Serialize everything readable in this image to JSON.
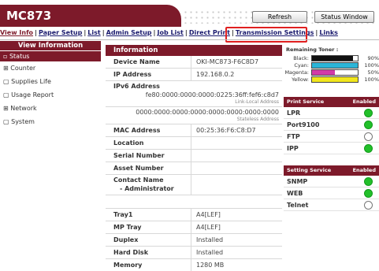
{
  "header": {
    "title": "MC873",
    "refresh_label": "Refresh",
    "status_window_label": "Status Window"
  },
  "nav": {
    "items": [
      {
        "label": "View Info"
      },
      {
        "label": "Paper Setup"
      },
      {
        "label": "List"
      },
      {
        "label": "Admin Setup"
      },
      {
        "label": "Job List"
      },
      {
        "label": "Direct Print"
      },
      {
        "label": "Transmission Settings"
      },
      {
        "label": "Links"
      }
    ]
  },
  "sidebar": {
    "header": "View Information",
    "items": [
      {
        "label": "Status",
        "icon": "bullet"
      },
      {
        "label": "Counter",
        "icon": "plus"
      },
      {
        "label": "Supplies Life",
        "icon": "bullet"
      },
      {
        "label": "Usage Report",
        "icon": "bullet"
      },
      {
        "label": "Network",
        "icon": "plus"
      },
      {
        "label": "System",
        "icon": "bullet"
      }
    ]
  },
  "info": {
    "header": "Information",
    "device_name_label": "Device Name",
    "device_name": "OKI-MC873-F6C8D7",
    "ip_label": "IP Address",
    "ip": "192.168.0.2",
    "ipv6_label": "IPv6 Address",
    "ipv6_link_local": "fe80:0000:0000:0000:0225:36ff:fef6:c8d7",
    "ipv6_link_local_note": "Link-Local Address",
    "ipv6_stateless": "0000:0000:0000:0000:0000:0000:0000:0000",
    "ipv6_stateless_note": "Stateless Address",
    "mac_label": "MAC Address",
    "mac": "00:25:36:F6:C8:D7",
    "location_label": "Location",
    "serial_label": "Serial Number",
    "asset_label": "Asset Number",
    "contact_label": "Contact Name",
    "contact_sub": "- Administrator",
    "tray1_label": "Tray1",
    "tray1": "A4[LEF]",
    "mptray_label": "MP Tray",
    "mptray": "A4[LEF]",
    "duplex_label": "Duplex",
    "duplex": "Installed",
    "hdd_label": "Hard Disk",
    "hdd": "Installed",
    "memory_label": "Memory",
    "memory": "1280 MB"
  },
  "toner": {
    "title": "Remaining Toner :",
    "items": [
      {
        "label": "Black:",
        "pct": "90%",
        "level": 0.9,
        "color": "#111111"
      },
      {
        "label": "Cyan:",
        "pct": "100%",
        "level": 1.0,
        "color": "#2bb5d8"
      },
      {
        "label": "Magenta:",
        "pct": "50%",
        "level": 0.5,
        "color": "#d23aa8"
      },
      {
        "label": "Yellow:",
        "pct": "100%",
        "level": 1.0,
        "color": "#f1e61c"
      }
    ]
  },
  "print_service": {
    "header": "Print Service",
    "enabled_header": "Enabled",
    "items": [
      {
        "name": "LPR",
        "enabled": true
      },
      {
        "name": "Port9100",
        "enabled": true
      },
      {
        "name": "FTP",
        "enabled": false
      },
      {
        "name": "IPP",
        "enabled": true
      }
    ]
  },
  "setting_service": {
    "header": "Setting Service",
    "enabled_header": "Enabled",
    "items": [
      {
        "name": "SNMP",
        "enabled": true
      },
      {
        "name": "WEB",
        "enabled": true
      },
      {
        "name": "Telnet",
        "enabled": false
      }
    ]
  },
  "colors": {
    "brand": "#7d1a2a",
    "enabled": "#22c02a",
    "highlight": "#e02020"
  }
}
